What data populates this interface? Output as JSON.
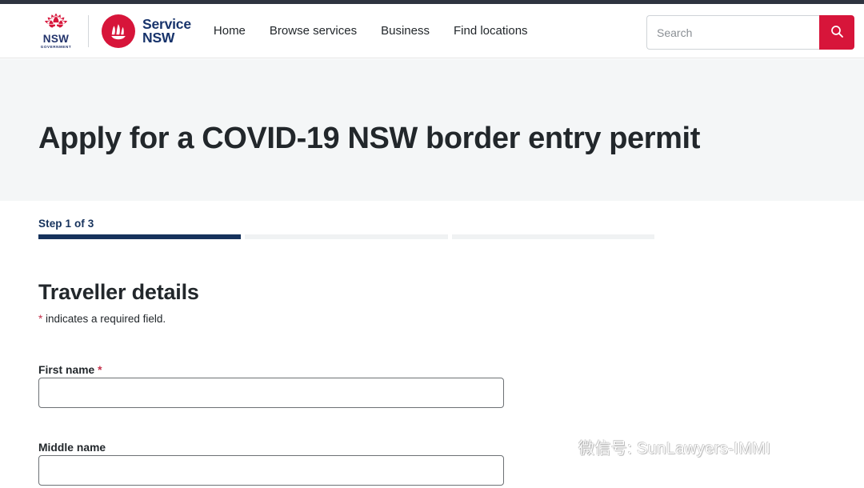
{
  "header": {
    "gov_logo": {
      "icon": "waratah-icon",
      "line1": "NSW",
      "line2": "GOVERNMENT"
    },
    "service_logo": {
      "icon": "service-nsw-emblem-icon",
      "line1": "Service",
      "line2": "NSW"
    },
    "nav": [
      {
        "label": "Home"
      },
      {
        "label": "Browse services"
      },
      {
        "label": "Business"
      },
      {
        "label": "Find locations"
      }
    ],
    "search": {
      "placeholder": "Search",
      "value": "",
      "button_icon": "search-icon"
    }
  },
  "hero": {
    "title": "Apply for a COVID-19 NSW border entry permit"
  },
  "step_indicator": {
    "label": "Step 1 of 3",
    "current": 1,
    "total": 3
  },
  "form": {
    "section_title": "Traveller details",
    "required_note_star": "*",
    "required_note_text": " indicates a required field.",
    "fields": [
      {
        "label": "First name",
        "required": true,
        "required_marker": "*",
        "value": "",
        "placeholder": ""
      },
      {
        "label": "Middle name",
        "required": false,
        "required_marker": "",
        "value": "",
        "placeholder": ""
      }
    ]
  },
  "watermark": {
    "icon": "wechat-icon",
    "text": "微信号: SunLawyers-IMMI"
  },
  "colors": {
    "brand_red": "#d7153a",
    "brand_navy": "#16325c",
    "text": "#22272b",
    "hero_bg": "#f4f6f7",
    "required_red": "#c4314b"
  }
}
